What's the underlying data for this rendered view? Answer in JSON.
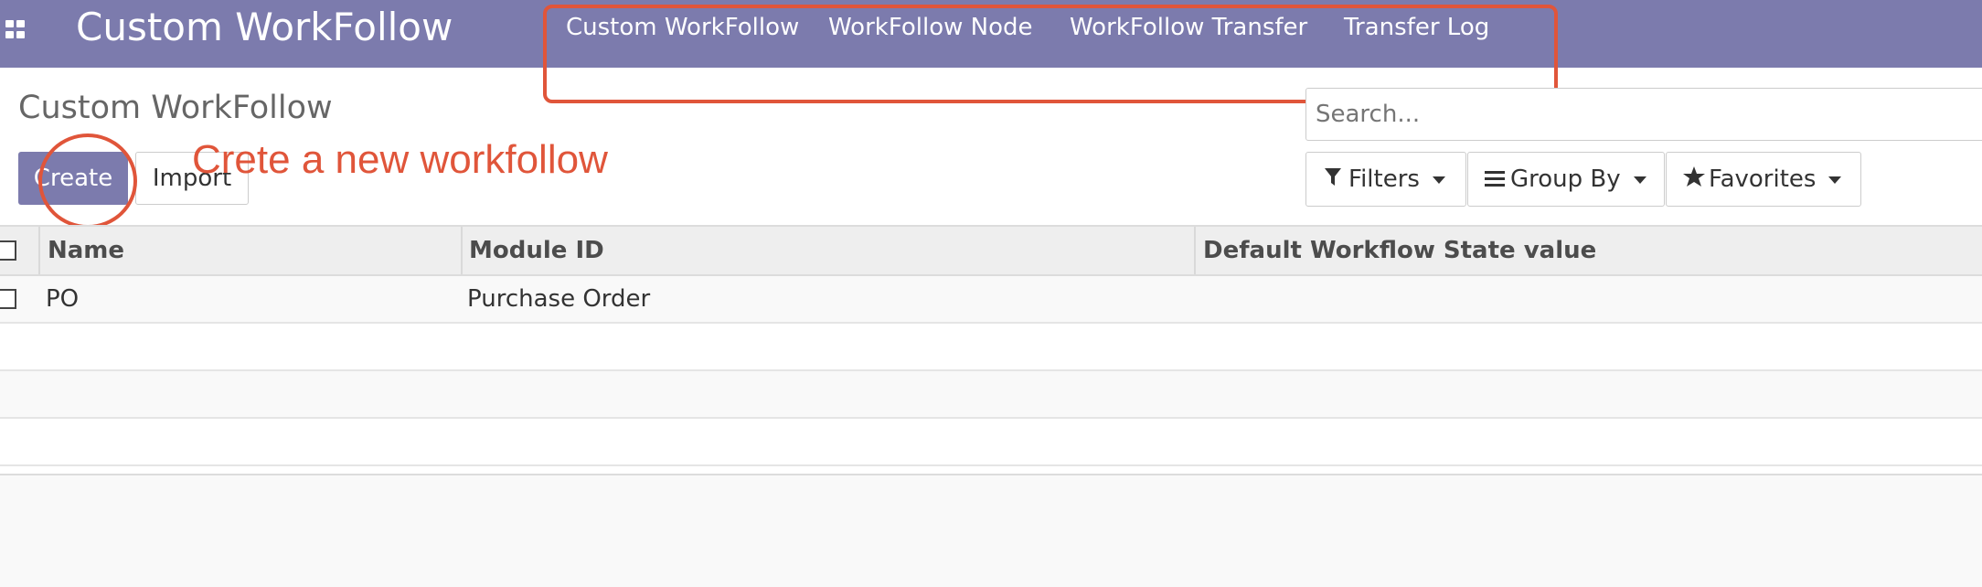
{
  "navbar": {
    "brand": "Custom WorkFollow",
    "menu": [
      "Custom WorkFollow",
      "WorkFollow Node",
      "WorkFollow Transfer",
      "Transfer Log"
    ]
  },
  "control_panel": {
    "breadcrumb": "Custom WorkFollow",
    "create_label": "Create",
    "import_label": "Import",
    "search_placeholder": "Search...",
    "filters_label": "Filters",
    "group_by_label": "Group By",
    "favorites_label": "Favorites"
  },
  "annotation": {
    "text": "Crete a new workfollow"
  },
  "table": {
    "headers": [
      "Name",
      "Module ID",
      "Default Workflow State value"
    ],
    "rows": [
      [
        "PO",
        "Purchase Order",
        ""
      ],
      [
        "",
        "",
        ""
      ],
      [
        "",
        "",
        ""
      ],
      [
        "",
        "",
        ""
      ]
    ]
  },
  "colors": {
    "brand": "#7c7bad",
    "annotation": "#e0553a"
  },
  "icons": {
    "apps": "grid-icon",
    "filters": "filter-icon",
    "group_by": "list-icon",
    "favorites": "star-icon"
  }
}
